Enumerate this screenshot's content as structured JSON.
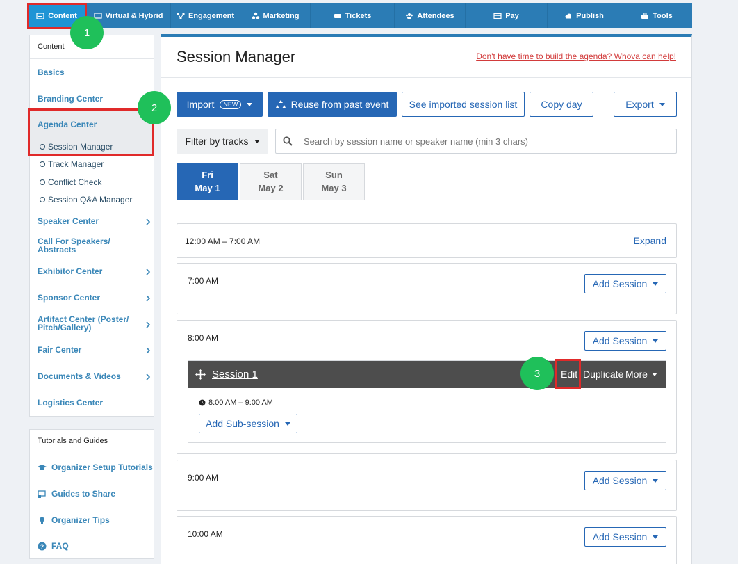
{
  "topnav": [
    {
      "label": "Content",
      "icon": "content-icon",
      "active": true
    },
    {
      "label": "Virtual & Hybrid",
      "icon": "monitor-icon"
    },
    {
      "label": "Engagement",
      "icon": "network-icon"
    },
    {
      "label": "Marketing",
      "icon": "marketing-icon"
    },
    {
      "label": "Tickets",
      "icon": "ticket-icon"
    },
    {
      "label": "Attendees",
      "icon": "people-icon"
    },
    {
      "label": "Pay",
      "icon": "card-icon"
    },
    {
      "label": "Publish",
      "icon": "cloud-upload-icon"
    },
    {
      "label": "Tools",
      "icon": "toolbox-icon"
    }
  ],
  "sidebar": {
    "header": "Content",
    "items": {
      "basics": "Basics",
      "branding": "Branding Center",
      "agenda": "Agenda Center",
      "speaker": "Speaker Center",
      "call_for_speakers": "Call For Speakers/ Abstracts",
      "exhibitor": "Exhibitor Center",
      "sponsor": "Sponsor Center",
      "artifact": "Artifact Center (Poster/ Pitch/Gallery)",
      "fair": "Fair Center",
      "documents": "Documents & Videos",
      "logistics": "Logistics Center"
    },
    "agenda_sub": {
      "session_manager": "Session Manager",
      "track_manager": "Track Manager",
      "conflict_check": "Conflict Check",
      "qa_manager": "Session Q&A Manager"
    },
    "guides_header": "Tutorials and Guides",
    "guides": {
      "tutorials": "Organizer Setup Tutorials",
      "share": "Guides to Share",
      "tips": "Organizer Tips",
      "faq": "FAQ"
    }
  },
  "markers": {
    "one": "1",
    "two": "2",
    "three": "3"
  },
  "main": {
    "title": "Session Manager",
    "help_link": "Don't have time to build the agenda? Whova can help!",
    "toolbar": {
      "import": "Import",
      "import_badge": "NEW",
      "reuse": "Reuse from past event",
      "see_imported": "See imported session list",
      "copy_day": "Copy day",
      "export": "Export"
    },
    "filter_label": "Filter by tracks",
    "search_placeholder": "Search by session name or speaker name (min 3 chars)",
    "days": [
      {
        "dow": "Fri",
        "date": "May 1",
        "active": true
      },
      {
        "dow": "Sat",
        "date": "May 2"
      },
      {
        "dow": "Sun",
        "date": "May 3"
      }
    ],
    "slots": {
      "collapsed": "12:00 AM – 7:00 AM",
      "expand": "Expand",
      "t7": "7:00 AM",
      "t8": "8:00 AM",
      "t9": "9:00 AM",
      "t10": "10:00 AM",
      "add_session": "Add Session"
    },
    "session": {
      "name": "Session 1",
      "edit": "Edit",
      "duplicate": "Duplicate",
      "more": "More",
      "time": "8:00 AM – 9:00 AM",
      "add_sub": "Add Sub-session"
    }
  },
  "colors": {
    "nav_blue": "#2b7cb5",
    "nav_active": "#1e94d5",
    "primary": "#2667b5",
    "link": "#3a87b8",
    "highlight_red": "#e02a2a",
    "marker_green": "#1fc05a",
    "session_bar": "#4d4d4d"
  }
}
